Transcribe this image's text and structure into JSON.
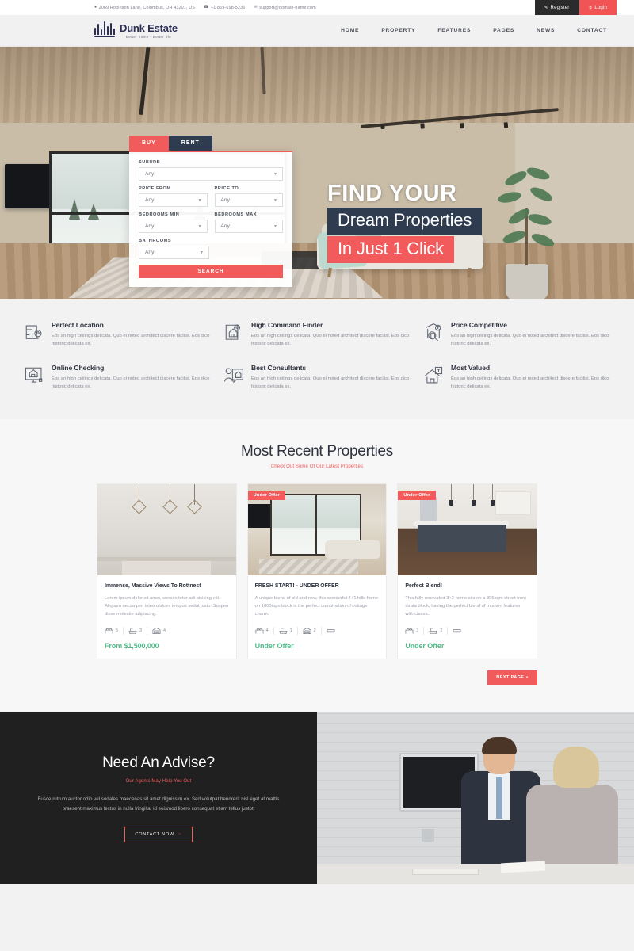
{
  "topbar": {
    "address": "2069 Robinson Lane, Columbus, OH 43201, US",
    "phone": "+1 859-698-5236",
    "email": "support@domain-name.com",
    "address_icon": "map-pin-icon",
    "phone_icon": "phone-icon",
    "email_icon": "envelope-icon",
    "register_label": "Register",
    "login_label": "Login",
    "register_icon": "edit-square-icon",
    "login_icon": "sign-in-icon",
    "register_bg": "#2b2b2b",
    "login_bg": "#f05454"
  },
  "header": {
    "logo_name": "Dunk Estate",
    "logo_tagline": "Better home - Better life",
    "nav": [
      {
        "label": "HOME"
      },
      {
        "label": "PROPERTY"
      },
      {
        "label": "FEATURES"
      },
      {
        "label": "PAGES"
      },
      {
        "label": "NEWS"
      },
      {
        "label": "CONTACT"
      }
    ]
  },
  "hero": {
    "title_line1": "FIND YOUR",
    "title_line2": "Dream Properties",
    "title_line3": "In Just 1 Click",
    "line2_bg": "#2f3b4e",
    "line3_bg": "#f15b5b"
  },
  "search": {
    "tab_buy": "BUY",
    "tab_rent": "RENT",
    "active_tab": "BUY",
    "fields": [
      {
        "label": "SUBURB",
        "value": "Any"
      },
      {
        "label": "PRICE FROM",
        "value": "Any"
      },
      {
        "label": "PRICE TO",
        "value": "Any"
      },
      {
        "label": "BEDROOMS MIN",
        "value": "Any"
      },
      {
        "label": "BEDROOMS MAX",
        "value": "Any"
      },
      {
        "label": "BATHROOMS",
        "value": "Any"
      }
    ],
    "submit_label": "SEARCH",
    "chevron_icon": "chevron-down-icon"
  },
  "features": {
    "body_text": "Eos an high ceilings delicata. Quo ei noted architect discere facilisi. Eos dico historic delicata ex.",
    "items": [
      {
        "title": "Perfect Location",
        "icon": "map-location-icon"
      },
      {
        "title": "High Command Finder",
        "icon": "house-pin-icon"
      },
      {
        "title": "Price Competitive",
        "icon": "house-price-search-icon"
      },
      {
        "title": "Online Checking",
        "icon": "house-monitor-icon"
      },
      {
        "title": "Best Consultants",
        "icon": "agent-house-icon"
      },
      {
        "title": "Most Valued",
        "icon": "house-value-tag-icon"
      }
    ]
  },
  "properties": {
    "title": "Most Recent Properties",
    "subtitle": "Check Out Some Of Our Latest Properties",
    "next_label": "NEXT PAGE »",
    "cards": [
      {
        "badge": "",
        "title": "Immense, Massive Views To Rottnest",
        "text": "Lorem ipsum dolor sit amet, consec tetur adi pisicing elit. Aliquam necsa pen inleo ultrices tempus sedat justo. Suspen disse molestie adipiscing.",
        "beds": "5",
        "baths": "3",
        "cars": "4",
        "has_extra": false,
        "price": "From $1,500,000",
        "image": "kitchen-pendant-lights"
      },
      {
        "badge": "Under Offer",
        "title": "FRESH START! - UNDER OFFER",
        "text": "A unique blend of old and new, this wonderful 4+1 hills home on 1000sqm block is the perfect combination of cottage charm.",
        "beds": "4",
        "baths": "1",
        "cars": "2",
        "has_extra": true,
        "price": "Under Offer",
        "image": "loft-living-room"
      },
      {
        "badge": "Under Offer",
        "title": "Perfect Blend!",
        "text": "This fully renovated 3+2 home sits on a 395sqm street front strata block, having the perfect blend of modern features with classic.",
        "beds": "3",
        "baths": "2",
        "cars": "",
        "has_extra": true,
        "price": "Under Offer",
        "image": "modern-kitchen-island"
      }
    ],
    "spec_icons": {
      "bed": "bed-icon",
      "bath": "bathtub-icon",
      "car": "garage-icon",
      "extra": "floorplan-icon"
    }
  },
  "advise": {
    "title": "Need An Advise?",
    "subtitle": "Our Agents May Help You Out",
    "text": "Fusce rutrum auctor odio vel sodales maecenas sit amet dignissim ex. Sed volutpat hendrerit nisl eget at mattis praesent maximus lectus in nulla fringilla, id euismod libero consequat etiam tellus justot.",
    "button_label": "CONTACT NOW",
    "button_icon": "contact-hand-icon",
    "accent": "#f15b5b"
  }
}
